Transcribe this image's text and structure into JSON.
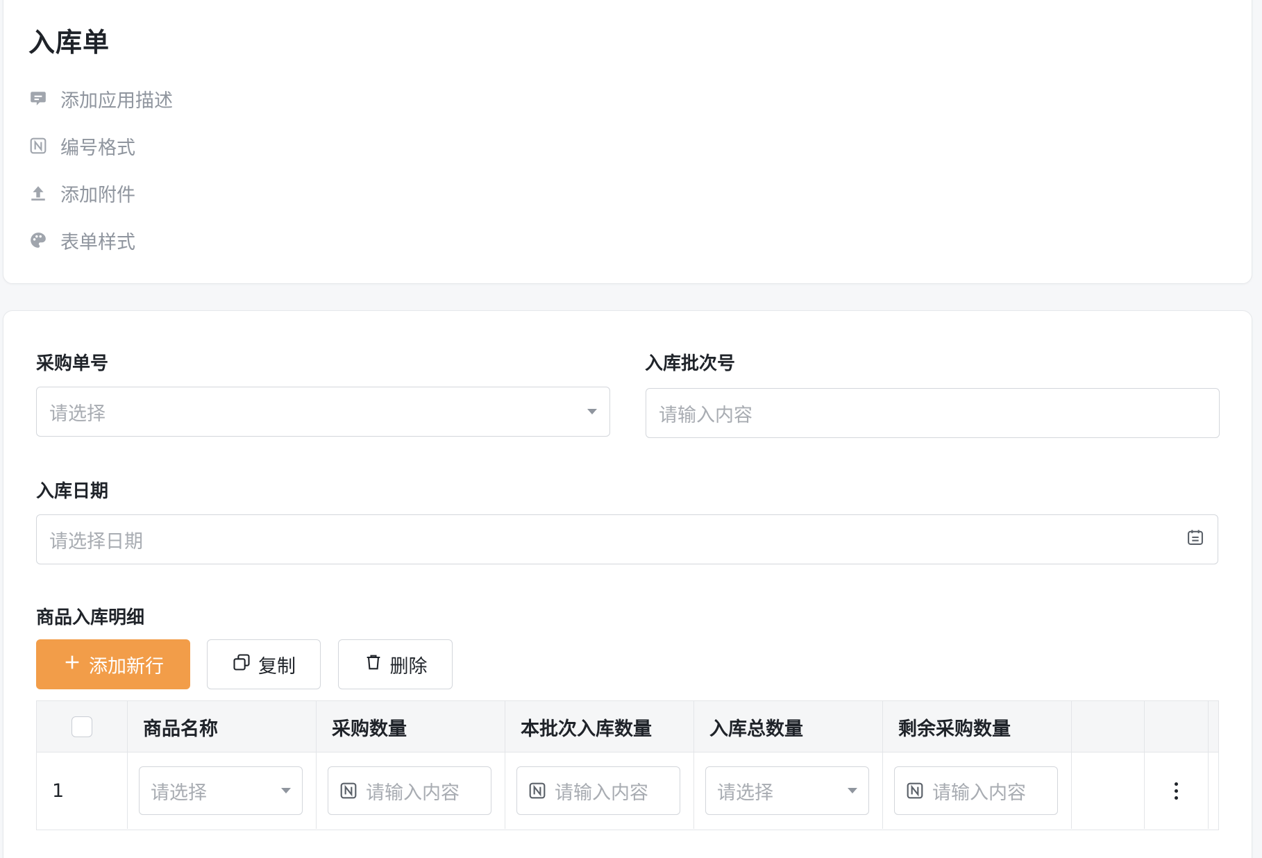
{
  "header": {
    "title": "入库单",
    "meta_items": [
      {
        "icon": "comment-icon",
        "label": "添加应用描述"
      },
      {
        "icon": "numbering-icon",
        "label": "编号格式"
      },
      {
        "icon": "upload-icon",
        "label": "添加附件"
      },
      {
        "icon": "palette-icon",
        "label": "表单样式"
      }
    ]
  },
  "form": {
    "purchase_no": {
      "label": "采购单号",
      "placeholder": "请选择"
    },
    "batch_no": {
      "label": "入库批次号",
      "placeholder": "请输入内容"
    },
    "inbound_date": {
      "label": "入库日期",
      "placeholder": "请选择日期"
    },
    "detail_section": {
      "label": "商品入库明细"
    }
  },
  "toolbar": {
    "add_label": "添加新行",
    "copy_label": "复制",
    "delete_label": "删除"
  },
  "table": {
    "columns": [
      "商品名称",
      "采购数量",
      "本批次入库数量",
      "入库总数量",
      "剩余采购数量"
    ],
    "rows": [
      {
        "index": "1",
        "product": "请选择",
        "purchase_qty": "请输入内容",
        "batch_qty": "请输入内容",
        "total_qty": "请选择",
        "remaining_qty": "请输入内容"
      }
    ]
  },
  "colors": {
    "primary": "#f29d49",
    "text": "#1f2329",
    "muted": "#8f959e",
    "border": "#d3d6db"
  }
}
